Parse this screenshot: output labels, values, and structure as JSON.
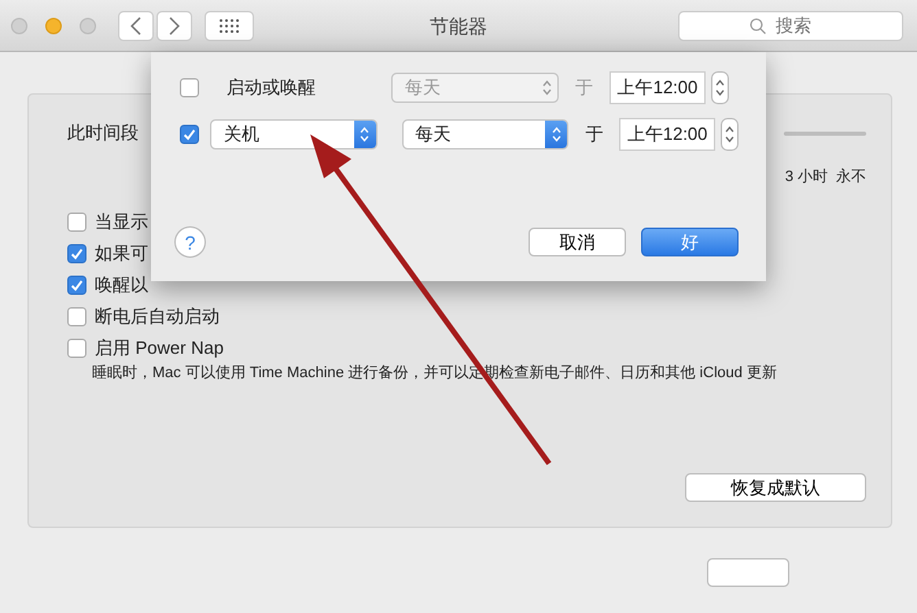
{
  "window": {
    "title": "节能器",
    "search": {
      "placeholder": "搜索"
    }
  },
  "panel": {
    "slider_label": "此时间段",
    "slider_ticks": [
      "3 小时",
      "永不"
    ],
    "options": [
      {
        "label": "当显示",
        "checked": false
      },
      {
        "label": "如果可",
        "checked": true
      },
      {
        "label": "唤醒以",
        "checked": true
      },
      {
        "label": "断电后自动启动",
        "checked": false
      },
      {
        "label": "启用 Power Nap",
        "checked": false
      }
    ],
    "power_nap_note": "睡眠时，Mac 可以使用 Time Machine 进行备份，并可以定期检查新电子邮件、日历和其他 iCloud 更新",
    "restore_button": "恢复成默认"
  },
  "schedule_sheet": {
    "rows": [
      {
        "checked": false,
        "event": "启动或唤醒",
        "kind": "label",
        "frequency": "每天",
        "at": "于",
        "time": "上午12:00"
      },
      {
        "checked": true,
        "event": "关机",
        "kind": "select",
        "frequency": "每天",
        "at": "于",
        "time": "上午12:00"
      }
    ],
    "help": "?",
    "buttons": [
      {
        "label": "取消",
        "default": false
      },
      {
        "label": "好",
        "default": true
      }
    ]
  }
}
